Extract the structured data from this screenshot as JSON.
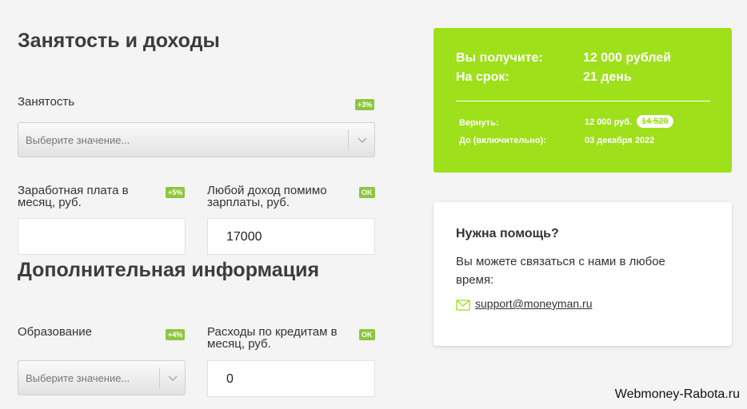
{
  "employment_section": {
    "title": "Занятость и доходы",
    "employment": {
      "label": "Занятость",
      "badge": "+3%",
      "placeholder": "Выберите значение..."
    },
    "salary": {
      "label": "Заработная плата в месяц, руб.",
      "badge": "+5%",
      "value": ""
    },
    "other_income": {
      "label": "Любой доход помимо зарплаты, руб.",
      "badge": "OK",
      "value": "17000"
    }
  },
  "additional_section": {
    "title": "Дополнительная информация",
    "education": {
      "label": "Образование",
      "badge": "+4%",
      "placeholder": "Выберите значение..."
    },
    "loan_expenses": {
      "label": "Расходы по кредитам в месяц, руб.",
      "badge": "OK",
      "value": "0"
    }
  },
  "summary": {
    "receive_label": "Вы получите:",
    "receive_value": "12 000 рублей",
    "term_label": "На срок:",
    "term_value": "21 день",
    "return_label": "Вернуть:",
    "return_value": "12 000 руб.",
    "return_old_value": "14 520",
    "due_label": "До (включительно):",
    "due_value": "03 декабря 2022",
    "accent_color": "#9ee01a"
  },
  "help": {
    "title": "Нужна помощь?",
    "text": "Вы можете связаться с нами в любое время:",
    "email": "support@moneyman.ru",
    "email_icon": "envelope-icon"
  },
  "watermark": "Webmoney-Rabota.ru"
}
